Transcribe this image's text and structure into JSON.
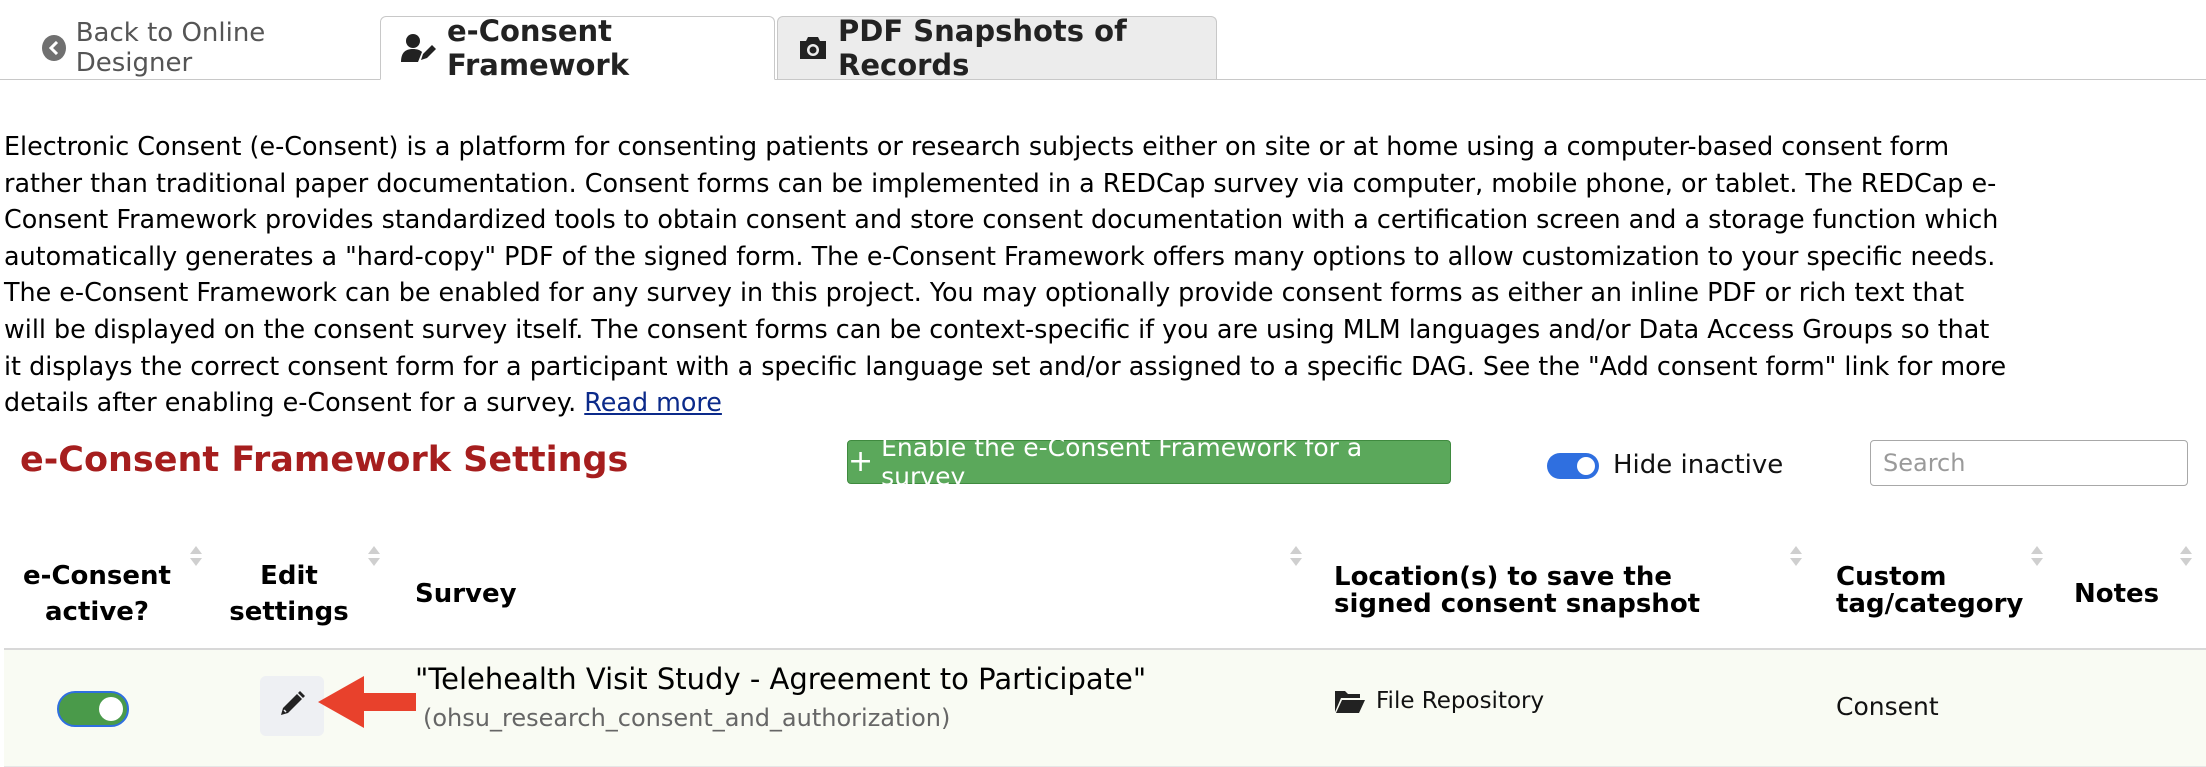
{
  "tabs": {
    "back_label": "Back to Online Designer",
    "econsent_label": "e-Consent Framework",
    "snapshots_label": "PDF Snapshots of Records"
  },
  "description": {
    "text": "Electronic Consent (e-Consent) is a platform for consenting patients or research subjects either on site or at home using a computer-based consent form rather than traditional paper documentation. Consent forms can be implemented in a REDCap survey via computer, mobile phone, or tablet. The REDCap e-Consent Framework provides standardized tools to obtain consent and store consent documentation with a certification screen and a storage function which automatically generates a \"hard-copy\" PDF of the signed form. The e-Consent Framework offers many options to allow customization to your specific needs. The e-Consent Framework can be enabled for any survey in this project. You may optionally provide consent forms as either an inline PDF or rich text that will be displayed on the consent survey itself. The consent forms can be context-specific if you are using MLM languages and/or Data Access Groups so that it displays the correct consent form for a participant with a specific language set and/or assigned to a specific DAG. See the \"Add consent form\" link for more details after enabling e-Consent for a survey.",
    "read_more": "Read more"
  },
  "settings": {
    "title": "e-Consent Framework Settings",
    "enable_button": "Enable the e-Consent Framework for a survey",
    "hide_inactive_label": "Hide inactive",
    "hide_inactive_on": true,
    "search_placeholder": "Search"
  },
  "table": {
    "columns": {
      "active": "e-Consent active?",
      "edit": "Edit settings",
      "survey": "Survey",
      "location": "Location(s) to save the signed consent snapshot",
      "tag": "Custom tag/category",
      "notes": "Notes"
    },
    "rows": [
      {
        "active": true,
        "survey_title": "\"Telehealth Visit Study - Agreement to Participate\"",
        "survey_var": "(ohsu_research_consent_and_authorization)",
        "location": "File Repository",
        "tag": "Consent",
        "notes": ""
      }
    ]
  },
  "colors": {
    "title_red": "#a61e1e",
    "button_green": "#5ba85b",
    "toggle_blue": "#2f6fe0",
    "arrow_red": "#e8412c"
  }
}
